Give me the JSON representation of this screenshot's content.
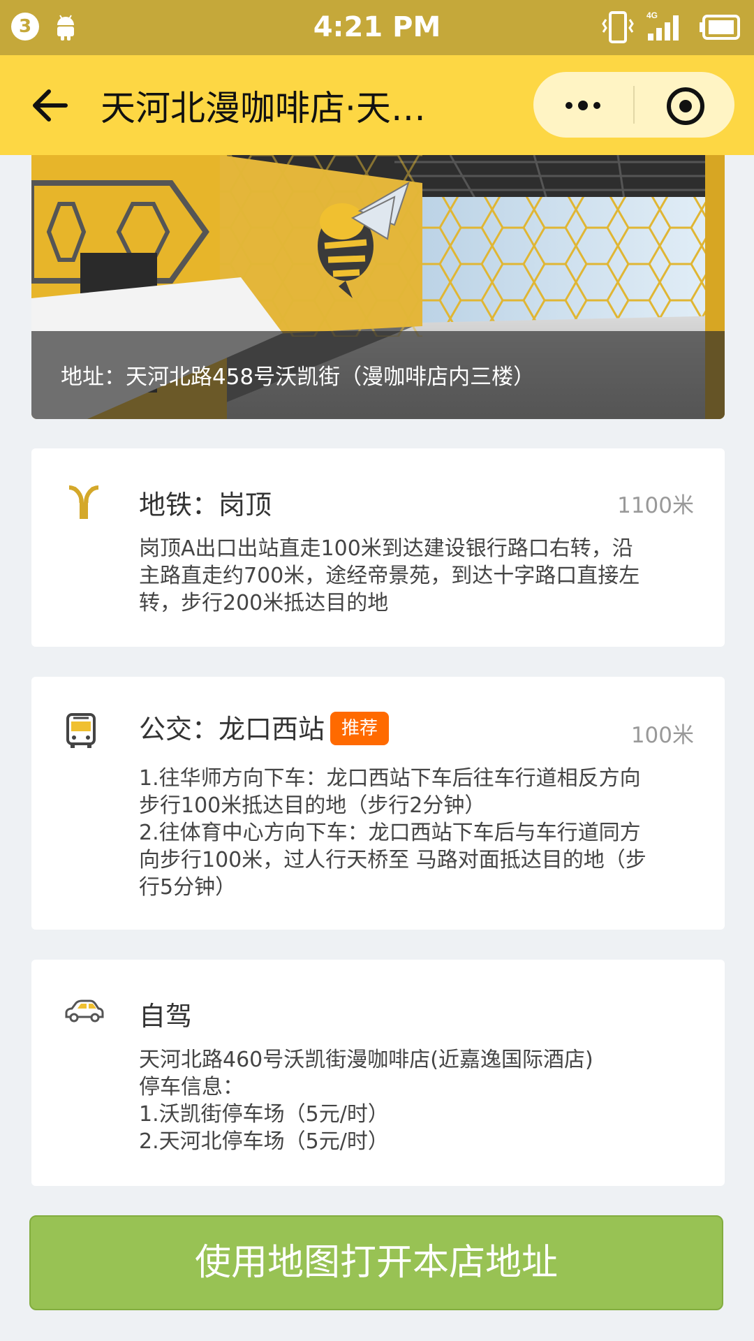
{
  "status_bar": {
    "notification_count": "3",
    "time": "4:21 PM",
    "network": "4G"
  },
  "nav": {
    "title": "天河北漫咖啡店·天…"
  },
  "banner": {
    "address": "地址：天河北路458号沃凯街（漫咖啡店内三楼）"
  },
  "routes": {
    "metro": {
      "title": "地铁：岗顶",
      "distance": "1100米",
      "lines": [
        "岗顶A出口出站直走100米到达建设银行路口右转，沿",
        "主路直走约700米，途经帝景苑，到达十字路口直接左",
        "转，步行200米抵达目的地"
      ]
    },
    "bus": {
      "title": "公交：龙口西站",
      "badge": "推荐",
      "distance": "100米",
      "lines": [
        "1.往华师方向下车：龙口西站下车后往车行道相反方向",
        "步行100米抵达目的地（步行2分钟）",
        "2.往体育中心方向下车：龙口西站下车后与车行道同方",
        "向步行100米，过人行天桥至 马路对面抵达目的地（步",
        "行5分钟）"
      ]
    },
    "drive": {
      "title": "自驾",
      "lines": [
        "天河北路460号沃凯街漫咖啡店(近嘉逸国际酒店)",
        "停车信息：",
        "1.沃凯街停车场（5元/时）",
        "2.天河北停车场（5元/时）"
      ]
    }
  },
  "actions": {
    "open_map": "使用地图打开本店地址"
  },
  "colors": {
    "status_bar": "#c5a83a",
    "nav_bar": "#fdd744",
    "metro_icon": "#d4a82a",
    "badge": "#ff6a00",
    "button": "#98c254"
  },
  "icons": {
    "metro": "metro-icon",
    "bus": "bus-icon",
    "car": "car-icon"
  }
}
